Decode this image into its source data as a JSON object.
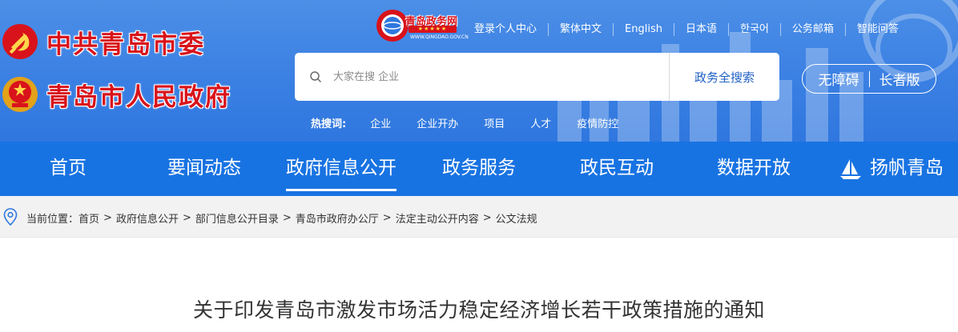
{
  "brand": {
    "party": "中共青岛市委",
    "government": "青岛市人民政府"
  },
  "portal_logo": {
    "name": "青岛政务网",
    "stars": "★★★★★",
    "url": "WWW.QINGDAO.GOV.CN"
  },
  "toplinks": [
    "登录个人中心",
    "繁体中文",
    "English",
    "日本语",
    "한국어",
    "公务邮箱",
    "智能问答"
  ],
  "search": {
    "placeholder": "大家在搜 企业",
    "button": "政务全搜索"
  },
  "access": {
    "barrier_free": "无障碍",
    "elderly": "长者版"
  },
  "hotwords": {
    "label": "热搜词:",
    "items": [
      "企业",
      "企业开办",
      "项目",
      "人才",
      "疫情防控"
    ]
  },
  "nav": {
    "items": [
      "首页",
      "要闻动态",
      "政府信息公开",
      "政务服务",
      "政民互动",
      "数据开放",
      "扬帆青岛"
    ],
    "active_index": 2
  },
  "breadcrumb": {
    "label": "当前位置：",
    "items": [
      "首页",
      "政府信息公开",
      "部门信息公开目录",
      "青岛市政府办公厅",
      "法定主动公开内容",
      "公文法规"
    ]
  },
  "document": {
    "title": "关于印发青岛市激发市场活力稳定经济增长若干政策措施的通知"
  },
  "colors": {
    "header_blue": "#3b80e3",
    "nav_blue": "#1873e2",
    "brand_red": "#d9131b"
  }
}
